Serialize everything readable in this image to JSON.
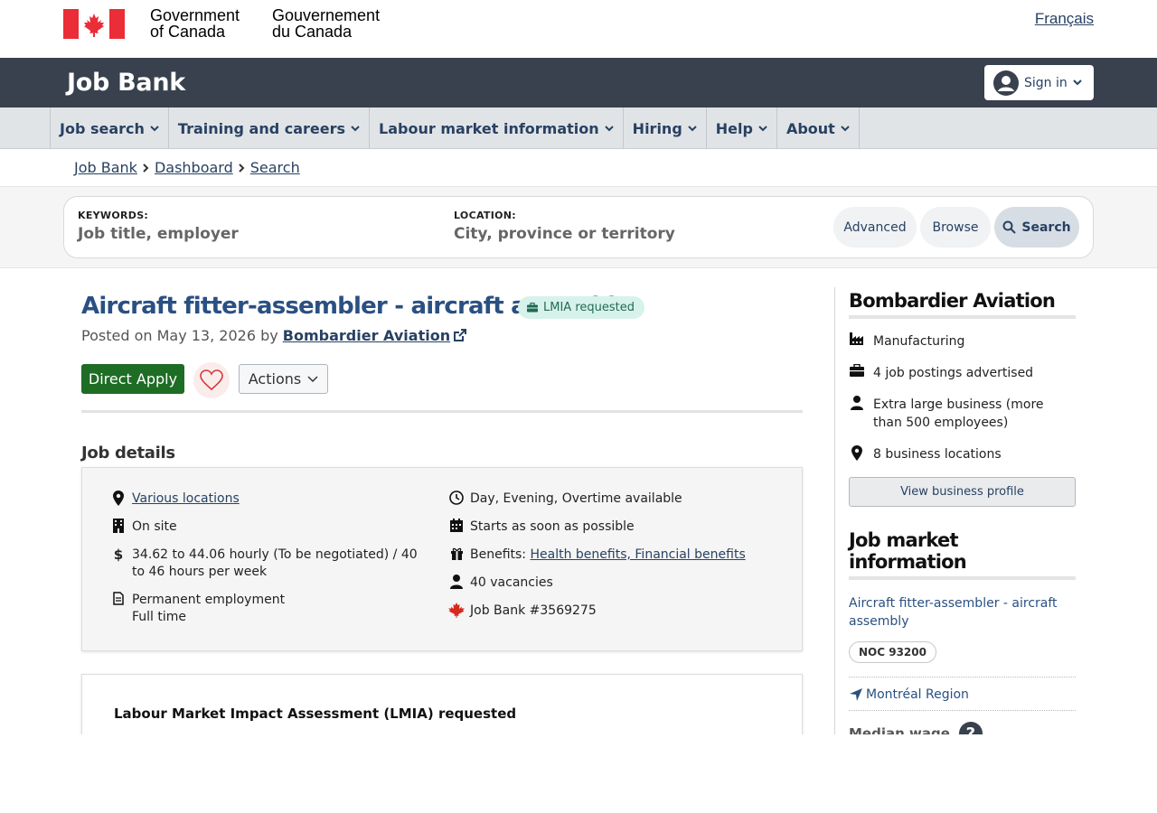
{
  "gc": {
    "name_en_1": "Government",
    "name_en_2": "of Canada",
    "name_fr_1": "Gouvernement",
    "name_fr_2": "du Canada",
    "language_link": "Français"
  },
  "banner": {
    "title": "Job Bank",
    "sign_in": "Sign in"
  },
  "nav": {
    "items": [
      "Job search",
      "Training and careers",
      "Labour market information",
      "Hiring",
      "Help",
      "About"
    ]
  },
  "breadcrumb": [
    "Job Bank",
    "Dashboard",
    "Search"
  ],
  "search": {
    "keywords_label": "KEYWORDS:",
    "keywords_placeholder": "Job title, employer",
    "location_label": "LOCATION:",
    "location_placeholder": "City, province or territory",
    "advanced": "Advanced",
    "browse": "Browse",
    "search": "Search"
  },
  "job": {
    "title": "Aircraft fitter-assembler - aircraft assembly",
    "badge": "LMIA requested",
    "posted_prefix": "Posted on May 13, 2026 by",
    "employer": "Bombardier Aviation",
    "apply": "Direct Apply",
    "actions": "Actions"
  },
  "details": {
    "heading": "Job details",
    "location": "Various locations",
    "worksite": "On site",
    "salary": "34.62 to 44.06 hourly (To be negotiated) / 40 to 46 hours per week",
    "employment_1": "Permanent employment",
    "employment_2": "Full time",
    "schedule": "Day, Evening, Overtime available",
    "start": "Starts as soon as possible",
    "benefits_label": "Benefits:",
    "benefits": "Health benefits, Financial benefits",
    "vacancies": "40 vacancies",
    "job_number": "Job Bank #3569275"
  },
  "lmia": {
    "title": "Labour Market Impact Assessment (LMIA) requested"
  },
  "employer_panel": {
    "heading": "Bombardier Aviation",
    "industry": "Manufacturing",
    "postings": "4 job postings advertised",
    "size": "Extra large business (more than 500 employees)",
    "locations": "8 business locations",
    "profile_button": "View business profile"
  },
  "market": {
    "heading": "Job market information",
    "occupation": "Aircraft fitter-assembler - aircraft assembly",
    "noc": "NOC 93200",
    "region": "Montréal Region",
    "median_wage": "Median wage",
    "help": "?"
  },
  "colors": {
    "nav_text": "#284162",
    "apply": "#1d6d24",
    "banner": "#38414d",
    "title": "#2a5082"
  }
}
